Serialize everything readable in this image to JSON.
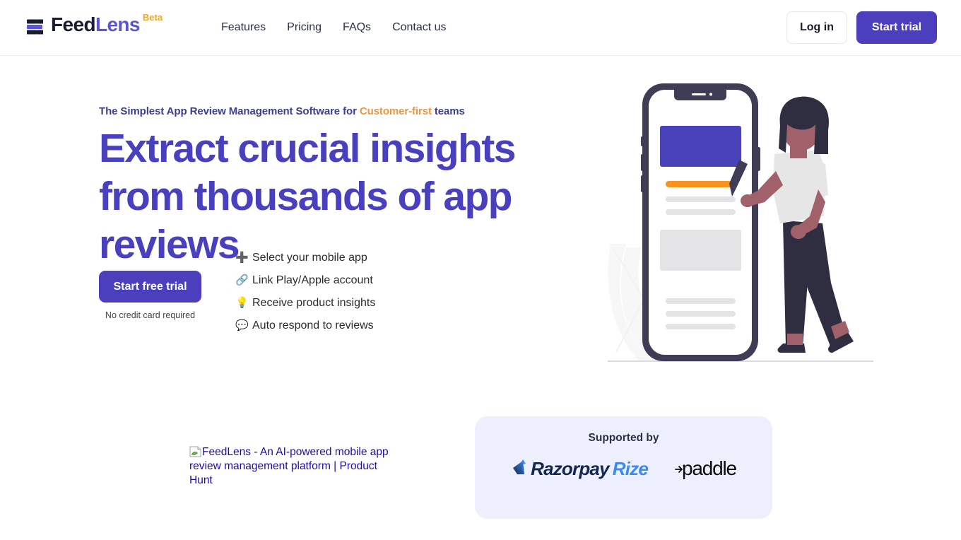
{
  "brand": {
    "logo_feed": "Feed",
    "logo_lens": "Lens",
    "badge": "Beta",
    "logo_icon": "feedlens-bars-icon",
    "purple": "#4C3FBE",
    "indigo": "#4840BE",
    "orange": "#F0953C",
    "amber": "#F5A623"
  },
  "header": {
    "nav": [
      {
        "label": "Features",
        "name": "nav-link-features"
      },
      {
        "label": "Pricing",
        "name": "nav-link-pricing"
      },
      {
        "label": "FAQs",
        "name": "nav-link-faqs"
      },
      {
        "label": "Contact us",
        "name": "nav-link-contact-us"
      }
    ],
    "login_label": "Log in",
    "start_trial_label": "Start trial"
  },
  "hero": {
    "eyebrow_before": "The Simplest App Review Management Software for ",
    "eyebrow_accent": "Customer-first",
    "eyebrow_after": " teams",
    "title": "Extract crucial insights from thousands of app reviews",
    "features": [
      {
        "icon": "➕",
        "icon_name": "plus-icon",
        "label": "Select your mobile app"
      },
      {
        "icon": "🔗",
        "icon_name": "link-icon",
        "label": "Link Play/Apple account"
      },
      {
        "icon": "💡",
        "icon_name": "lightbulb-icon",
        "label": "Receive product insights"
      },
      {
        "icon": "💬",
        "icon_name": "speech-balloon-icon",
        "label": "Auto respond to reviews"
      }
    ],
    "cta_label": "Start free trial",
    "cta_note": "No credit card required",
    "illustration_name": "phone-mockup-with-woman-illustration"
  },
  "bottom": {
    "product_hunt_alt": "FeedLens - An AI-powered mobile app review management platform | Product Hunt",
    "supported_title": "Supported by",
    "logos": [
      {
        "name": "razorpay-rize-logo",
        "part1": "Razorpay",
        "part2": "Rize"
      },
      {
        "name": "paddle-logo",
        "text": "paddle"
      }
    ]
  }
}
